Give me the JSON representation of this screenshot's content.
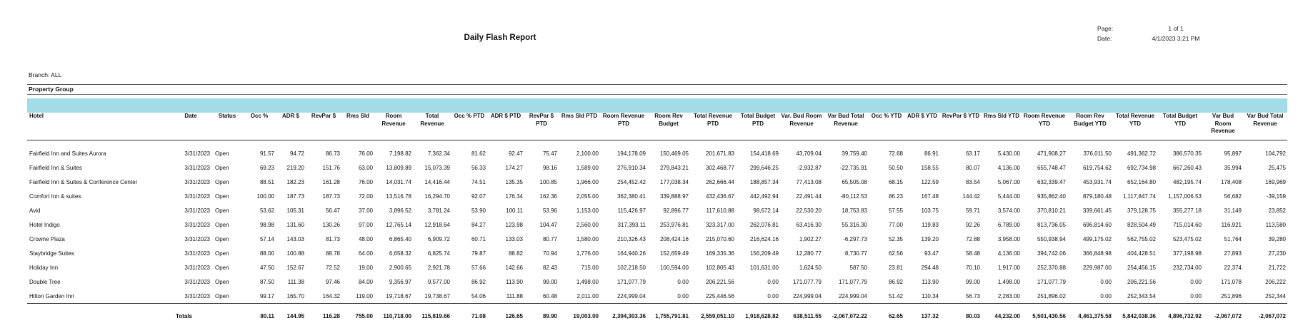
{
  "report": {
    "title": "Daily Flash Report",
    "page_label": "Page:",
    "page_value": "1 of 1",
    "date_label": "Date:",
    "date_value": "4/1/2023 3:21 PM",
    "branch": "Branch:  ALL",
    "property_group": "Property Group"
  },
  "columns": [
    {
      "label": "Hotel"
    },
    {
      "label": "Date"
    },
    {
      "label": "Status"
    },
    {
      "label": "Occ %"
    },
    {
      "label": "ADR $"
    },
    {
      "label": "RevPar $"
    },
    {
      "label": "Rms Sld"
    },
    {
      "label": "Room Revenue"
    },
    {
      "label": "Total Revenue"
    },
    {
      "label": "Occ % PTD"
    },
    {
      "label": "ADR $ PTD"
    },
    {
      "label": "RevPar $ PTD"
    },
    {
      "label": "Rms Sld PTD"
    },
    {
      "label": "Room Revenue PTD"
    },
    {
      "label": "Room Rev Budget"
    },
    {
      "label": "Total Revenue PTD"
    },
    {
      "label": "Total Budget PTD"
    },
    {
      "label": "Var. Bud Room Revenue"
    },
    {
      "label": "Var Bud Total Revenue"
    },
    {
      "label": "Occ % YTD"
    },
    {
      "label": "ADR $ YTD"
    },
    {
      "label": "RevPar $ YTD"
    },
    {
      "label": "Rms Sld YTD"
    },
    {
      "label": "Room Revenue YTD"
    },
    {
      "label": "Room Rev Budget YTD"
    },
    {
      "label": "Total Revenue YTD"
    },
    {
      "label": "Total Budget YTD"
    },
    {
      "label": "Var Bud Room Revenue"
    },
    {
      "label": "Var Bud Total Revenue"
    }
  ],
  "rows": [
    [
      "Fairfield Inn and Suites Aurora",
      "3/31/2023",
      "Open",
      "91.57",
      "94.72",
      "86.73",
      "76.00",
      "7,198.82",
      "7,362.34",
      "81.62",
      "92.47",
      "75.47",
      "2,100.00",
      "194,178.09",
      "150,469.05",
      "201,671.83",
      "154,418.69",
      "43,709.04",
      "39,759.40",
      "72.68",
      "86.91",
      "63.17",
      "5,430.00",
      "471,908.27",
      "376,011.50",
      "491,362.72",
      "386,570.35",
      "95,897",
      "104,792"
    ],
    [
      "Fairfield Inn & Suites",
      "3/31/2023",
      "Open",
      "69.23",
      "219.20",
      "151.76",
      "63.00",
      "13,809.89",
      "15,073.39",
      "56.33",
      "174.27",
      "98.16",
      "1,589.00",
      "276,910.34",
      "279,843.21",
      "302,468.77",
      "299,646.25",
      "-2,932.87",
      "-22,735.91",
      "50.50",
      "158.55",
      "80.07",
      "4,136.00",
      "655,748.47",
      "619,754.62",
      "692,734.98",
      "667,260.43",
      "35,994",
      "25,475"
    ],
    [
      "Fairfield Inn & Suites & Conference Center",
      "3/31/2023",
      "Open",
      "88.51",
      "182.23",
      "161.28",
      "76.00",
      "14,031.74",
      "14,416.44",
      "74.51",
      "135.35",
      "100.85",
      "1,966.00",
      "254,452.42",
      "177,038.34",
      "262,666.44",
      "188,857.34",
      "77,413.08",
      "65,505.08",
      "68.15",
      "122.59",
      "83.54",
      "5,067.00",
      "632,339.47",
      "453,931.74",
      "652,164.80",
      "482,195.74",
      "178,408",
      "169,969"
    ],
    [
      "Comfort Inn & suites",
      "3/31/2023",
      "Open",
      "100.00",
      "187.73",
      "187.73",
      "72.00",
      "13,516.78",
      "16,294.70",
      "92.07",
      "176.34",
      "162.36",
      "2,055.00",
      "362,380.41",
      "339,888.97",
      "432,436.67",
      "442,492.94",
      "22,491.44",
      "-80,112.53",
      "86.23",
      "167.48",
      "144.42",
      "5,444.00",
      "935,862.40",
      "879,180.48",
      "1,117,847.74",
      "1,157,006.53",
      "56,682",
      "-39,159"
    ],
    [
      "Avid",
      "3/31/2023",
      "Open",
      "53.62",
      "105.31",
      "56.47",
      "37.00",
      "3,896.52",
      "3,781.24",
      "53.90",
      "100.11",
      "53.96",
      "1,153.00",
      "115,426.97",
      "92,896.77",
      "117,610.88",
      "98,672.14",
      "22,530.20",
      "18,753.83",
      "57.55",
      "103.75",
      "59.71",
      "3,574.00",
      "370,810.21",
      "339,661.45",
      "379,128.75",
      "355,277.18",
      "31,149",
      "23,852"
    ],
    [
      "Hotel Indigo",
      "3/31/2023",
      "Open",
      "98.98",
      "131.60",
      "130.26",
      "97.00",
      "12,765.14",
      "12,918.64",
      "84.27",
      "123.98",
      "104.47",
      "2,560.00",
      "317,393.11",
      "253,976.81",
      "323,317.00",
      "262,076.81",
      "63,416.30",
      "55,316.30",
      "77.00",
      "119.83",
      "92.26",
      "6,789.00",
      "813,736.05",
      "696,814.60",
      "828,504.49",
      "715,014.60",
      "116,921",
      "113,580"
    ],
    [
      "Crowne Plaza",
      "3/31/2023",
      "Open",
      "57.14",
      "143.03",
      "81.73",
      "48.00",
      "6,865.40",
      "6,909.72",
      "60.71",
      "133.03",
      "80.77",
      "1,580.00",
      "210,326.43",
      "208,424.16",
      "215,070.60",
      "216,624.16",
      "1,902.27",
      "-6,297.73",
      "52.35",
      "139.20",
      "72.88",
      "3,958.00",
      "550,938.94",
      "499,175.02",
      "562,755.02",
      "523,475.02",
      "51,764",
      "39,280"
    ],
    [
      "Staybridge Suites",
      "3/31/2023",
      "Open",
      "88.00",
      "100.88",
      "88.78",
      "64.00",
      "6,658.32",
      "6,825.74",
      "79.87",
      "88.82",
      "70.94",
      "1,776.00",
      "164,940.26",
      "152,659.49",
      "169,335.36",
      "156,209.49",
      "12,280.77",
      "8,730.77",
      "62.56",
      "93.47",
      "58.48",
      "4,136.00",
      "394,742.06",
      "366,848.98",
      "404,428.51",
      "377,198.98",
      "27,893",
      "27,230"
    ],
    [
      "Holiday Inn",
      "3/31/2023",
      "Open",
      "47.50",
      "152.67",
      "72.52",
      "19.00",
      "2,900.65",
      "2,921.78",
      "57.66",
      "142.66",
      "82.43",
      "715.00",
      "102,218.50",
      "100,594.00",
      "102,805.43",
      "101,631.00",
      "1,624.50",
      "587.50",
      "23.81",
      "294.48",
      "70.10",
      "1,917.00",
      "252,370.88",
      "229,987.00",
      "254,456.15",
      "232,734.00",
      "22,374",
      "21,722"
    ],
    [
      "Double Tree",
      "3/31/2023",
      "Open",
      "87.50",
      "111.38",
      "97.46",
      "84.00",
      "9,356.97",
      "9,577.00",
      "86.92",
      "113.90",
      "99.00",
      "1,498.00",
      "171,077.79",
      "0.00",
      "206,221.56",
      "0.00",
      "171,077.79",
      "171,077.79",
      "86.92",
      "113.90",
      "99.00",
      "1,498.00",
      "171,077.79",
      "0.00",
      "206,221.56",
      "0.00",
      "171,078",
      "206,222"
    ],
    [
      "Hilton Garden Inn",
      "3/31/2023",
      "Open",
      "99.17",
      "165.70",
      "164.32",
      "119.00",
      "19,718.67",
      "19,738.67",
      "54.06",
      "111.88",
      "60.48",
      "2,011.00",
      "224,999.04",
      "0.00",
      "225,446.56",
      "0.00",
      "224,999.04",
      "224,999.04",
      "51.42",
      "110.34",
      "56.73",
      "2,283.00",
      "251,896.02",
      "0.00",
      "252,343.54",
      "0.00",
      "251,896",
      "252,344"
    ]
  ],
  "totals": [
    "Totals",
    "80.11",
    "144.95",
    "116.28",
    "755.00",
    "110,718.00",
    "115,819.66",
    "71.08",
    "126.65",
    "89.90",
    "19,003.00",
    "2,394,303.36",
    "1,755,791.81",
    "2,559,051.10",
    "1,918,628.82",
    "638,511.55",
    "-2,067,072.22",
    "62.65",
    "137.32",
    "80.03",
    "44,232.00",
    "5,501,430.56",
    "4,461,375.58",
    "5,842,038.36",
    "4,896,732.92",
    "-2,067,072",
    "-2,067,072"
  ]
}
